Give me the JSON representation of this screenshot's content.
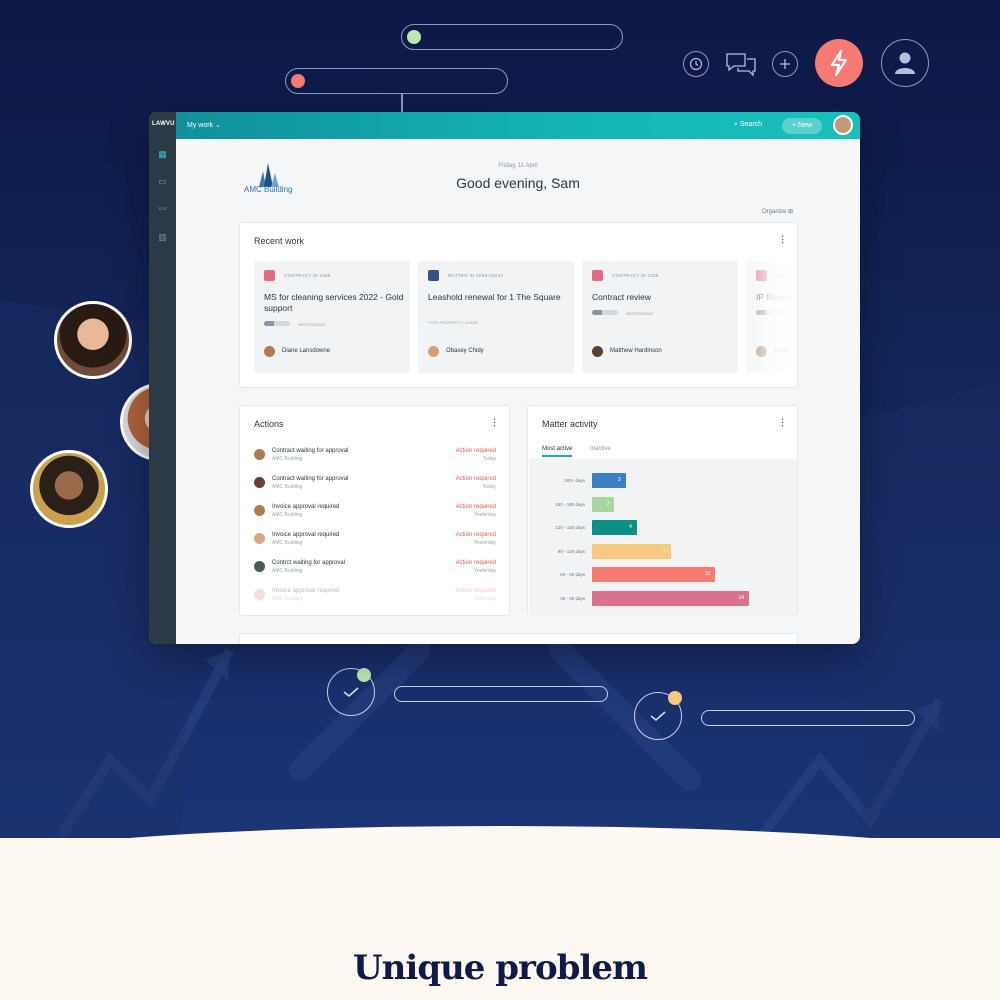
{
  "app": {
    "logo": "LAWVU",
    "workspace_menu": "My work",
    "search_label": "Search",
    "new_label": "New"
  },
  "sidebar": [
    {
      "name": "dashboard-icon",
      "active": true
    },
    {
      "name": "briefcase-icon",
      "active": false
    },
    {
      "name": "signature-icon",
      "active": false
    },
    {
      "name": "library-icon",
      "active": false
    }
  ],
  "header": {
    "date": "Friday, 11 April",
    "greeting": "Good evening, Sam",
    "brand_name": "AMC Building",
    "organize_label": "Organize"
  },
  "recent_work": {
    "title": "Recent work",
    "items": [
      {
        "id": "CONTRACT ID 2365",
        "title": "MS for cleaning services 2022 - Gold support",
        "meta": "",
        "status": "NEGOTIATING",
        "progress": 0.4,
        "person": "Diane Lansdowne",
        "icon_color": "#e06c84",
        "avatar_color": "#b07a52"
      },
      {
        "id": "MATTER ID 0009-02044",
        "title": "Leashold renewal for 1 The Square",
        "meta": "TYPE PROPERTY • LEASE",
        "status": "",
        "progress": null,
        "person": "Obasey Chidy",
        "icon_color": "#3a4f86",
        "avatar_color": "#d0a07a"
      },
      {
        "id": "CONTRACT ID 2335",
        "title": "Contract review",
        "meta": "",
        "status": "NEGOTIATING",
        "progress": 0.4,
        "person": "Matthew Hardinson",
        "icon_color": "#e06c84",
        "avatar_color": "#5a4032"
      },
      {
        "id": "CONTRACT",
        "title": "IP Request",
        "meta": "",
        "status": "NEGOTIATING",
        "progress": 0.4,
        "person": "Carlos",
        "icon_color": "#e06c84",
        "avatar_color": "#a08060"
      }
    ]
  },
  "actions": {
    "title": "Actions",
    "items": [
      {
        "title": "Contract waiting for approval",
        "sub": "AMC Building",
        "status": "Action required",
        "when": "Today",
        "avatar_color": "#b07a52"
      },
      {
        "title": "Contract waiting for approval",
        "sub": "AMC Building",
        "status": "Action required",
        "when": "Today",
        "avatar_color": "#6a3d35"
      },
      {
        "title": "Invoice approval required",
        "sub": "AMC Building",
        "status": "Action required",
        "when": "Yesterday",
        "avatar_color": "#b07a52"
      },
      {
        "title": "Invoice approval required",
        "sub": "AMC Building",
        "status": "Action required",
        "when": "Yesterday",
        "avatar_color": "#d8a786"
      },
      {
        "title": "Contrct waiting for approval",
        "sub": "AMC Building",
        "status": "Action required",
        "when": "Yesterday",
        "avatar_color": "#4d5a50"
      },
      {
        "title": "Invoice approval required",
        "sub": "AMC Building",
        "status": "Action required",
        "when": "Yesterday",
        "avatar_color": "#d8a786"
      }
    ]
  },
  "matter_activity": {
    "title": "Matter activity",
    "tabs": [
      "Most active",
      "Inactive"
    ]
  },
  "chart_data": {
    "type": "bar",
    "orientation": "horizontal",
    "categories": [
      "180+ days",
      "150 - 180 days",
      "120 - 150 days",
      "90 - 120 days",
      "60 - 90 days",
      "30 - 60 days"
    ],
    "values": [
      3,
      2,
      4,
      7,
      11,
      14
    ],
    "colors": [
      "#3b7fc4",
      "#a8d5a0",
      "#0e8f86",
      "#f7c97e",
      "#f47a72",
      "#d9728f"
    ]
  },
  "page": {
    "heading": "Unique problem"
  },
  "colors": {
    "hero_bg": "#132559",
    "accent_teal": "#15b5b6",
    "accent_coral": "#f47a72",
    "cream": "#fdf8f1"
  }
}
